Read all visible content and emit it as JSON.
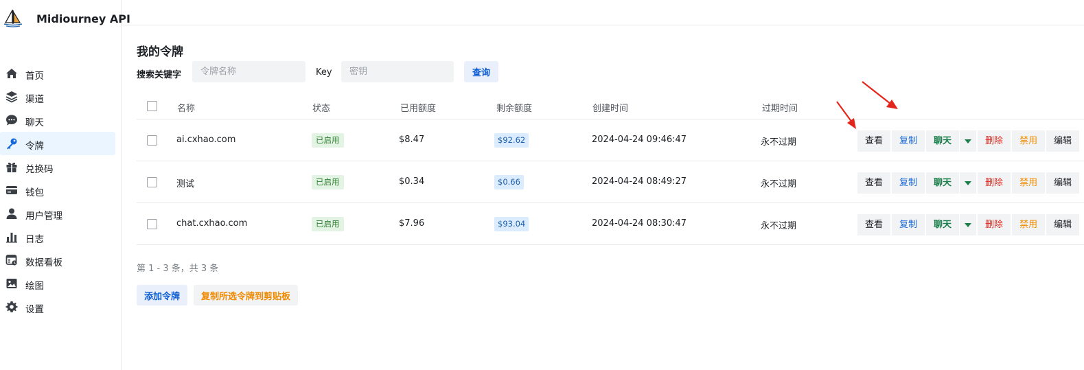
{
  "brand": {
    "title": "Midiourney API"
  },
  "sidebar": {
    "items": [
      {
        "label": "首页",
        "icon": "home-icon"
      },
      {
        "label": "渠道",
        "icon": "layers-icon"
      },
      {
        "label": "聊天",
        "icon": "chat-bubble-icon"
      },
      {
        "label": "令牌",
        "icon": "key-icon",
        "active": true
      },
      {
        "label": "兑换码",
        "icon": "gift-icon"
      },
      {
        "label": "钱包",
        "icon": "wallet-icon"
      },
      {
        "label": "用户管理",
        "icon": "user-icon"
      },
      {
        "label": "日志",
        "icon": "bar-chart-icon"
      },
      {
        "label": "数据看板",
        "icon": "dashboard-icon"
      },
      {
        "label": "绘图",
        "icon": "image-icon"
      },
      {
        "label": "设置",
        "icon": "gear-icon"
      }
    ]
  },
  "main": {
    "title": "我的令牌",
    "search": {
      "label": "搜索关键字",
      "name_placeholder": "令牌名称",
      "key_label": "Key",
      "key_placeholder": "密钥",
      "query_label": "查询"
    },
    "table": {
      "columns": [
        "名称",
        "状态",
        "已用额度",
        "剩余额度",
        "创建时间",
        "过期时间"
      ],
      "rows": [
        {
          "name": "ai.cxhao.com",
          "status": "已启用",
          "used": "$8.47",
          "remain": "$92.62",
          "created": "2024-04-24 09:46:47",
          "expires": "永不过期"
        },
        {
          "name": "测试",
          "status": "已启用",
          "used": "$0.34",
          "remain": "$0.66",
          "created": "2024-04-24 08:49:27",
          "expires": "永不过期"
        },
        {
          "name": "chat.cxhao.com",
          "status": "已启用",
          "used": "$7.96",
          "remain": "$93.04",
          "created": "2024-04-24 08:30:47",
          "expires": "永不过期"
        }
      ],
      "actions": {
        "view": "查看",
        "copy": "复制",
        "chat": "聊天",
        "delete": "删除",
        "disable": "禁用",
        "edit": "编辑"
      }
    },
    "pager": "第 1 - 3 条，共 3 条",
    "add_label": "添加令牌",
    "copy_selected_label": "复制所选令牌到剪贴板"
  },
  "colors": {
    "accent": "#0b5bd3",
    "status_green": "#2f7d32",
    "danger": "#e3261c",
    "warning": "#f08a00",
    "active_nav_bg": "#eaf5ff",
    "arrow": "#e3261c"
  }
}
